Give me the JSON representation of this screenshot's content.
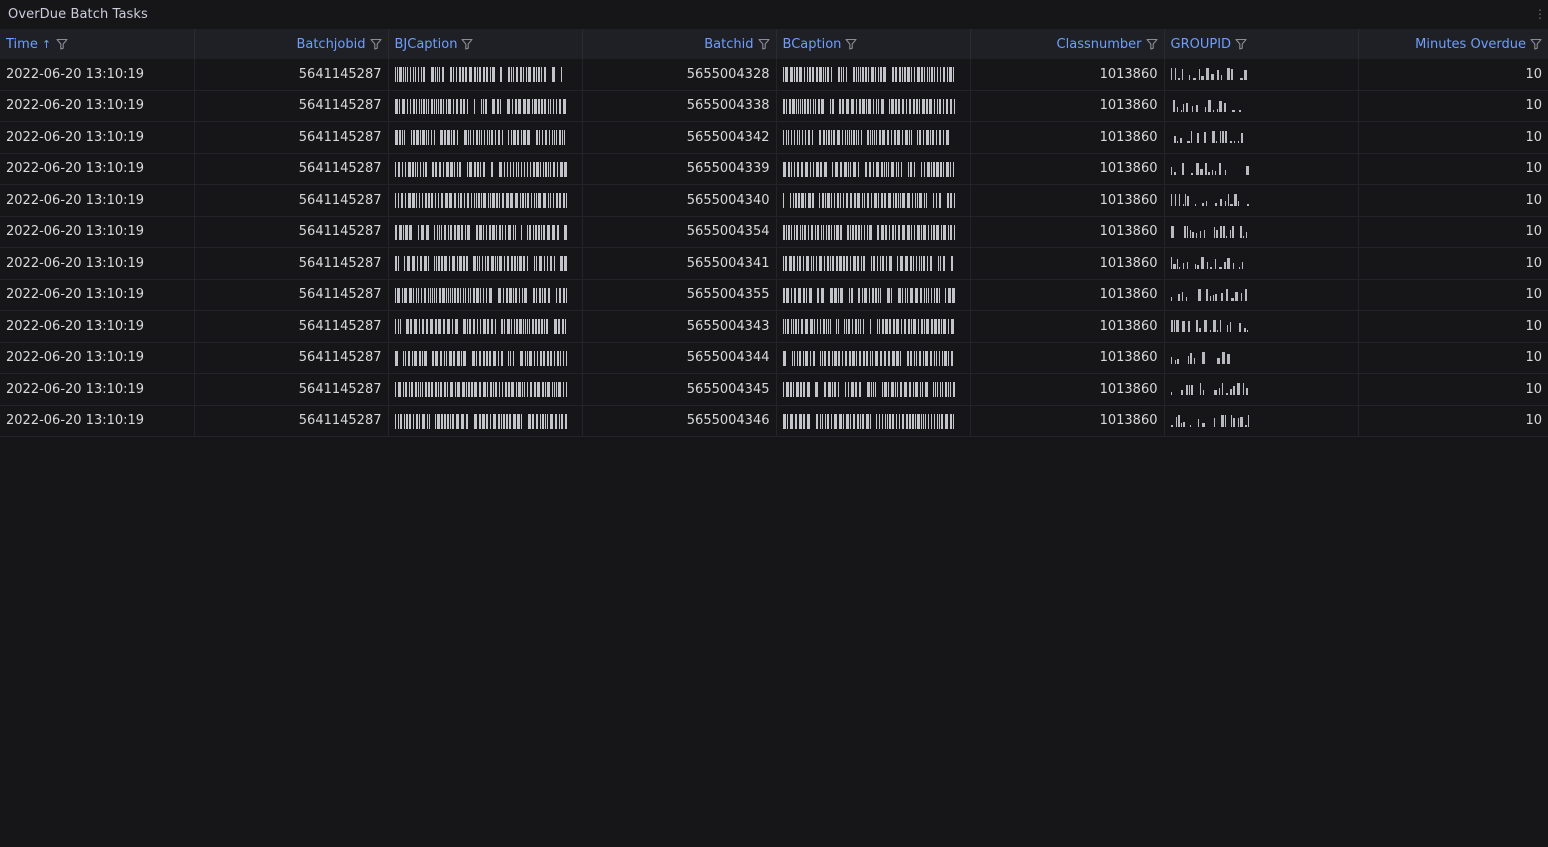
{
  "panel": {
    "title": "OverDue Batch Tasks",
    "menu_glyph": "⋮"
  },
  "table": {
    "columns": [
      {
        "label": "Time",
        "align": "left",
        "sorted": "asc",
        "sort_glyph": "↑"
      },
      {
        "label": "Batchjobid",
        "align": "right"
      },
      {
        "label": "BJCaption",
        "align": "left",
        "redacted": true
      },
      {
        "label": "Batchid",
        "align": "right"
      },
      {
        "label": "BCaption",
        "align": "left",
        "redacted": true
      },
      {
        "label": "Classnumber",
        "align": "right"
      },
      {
        "label": "GROUPID",
        "align": "left",
        "redacted": true
      },
      {
        "label": "Minutes Overdue",
        "align": "right"
      }
    ],
    "rows": [
      {
        "time": "2022-06-20 13:10:19",
        "batchjobid": "5641145287",
        "batchid": "5655004328",
        "classnumber": "1013860",
        "minutes_overdue": "10"
      },
      {
        "time": "2022-06-20 13:10:19",
        "batchjobid": "5641145287",
        "batchid": "5655004338",
        "classnumber": "1013860",
        "minutes_overdue": "10"
      },
      {
        "time": "2022-06-20 13:10:19",
        "batchjobid": "5641145287",
        "batchid": "5655004342",
        "classnumber": "1013860",
        "minutes_overdue": "10"
      },
      {
        "time": "2022-06-20 13:10:19",
        "batchjobid": "5641145287",
        "batchid": "5655004339",
        "classnumber": "1013860",
        "minutes_overdue": "10"
      },
      {
        "time": "2022-06-20 13:10:19",
        "batchjobid": "5641145287",
        "batchid": "5655004340",
        "classnumber": "1013860",
        "minutes_overdue": "10"
      },
      {
        "time": "2022-06-20 13:10:19",
        "batchjobid": "5641145287",
        "batchid": "5655004354",
        "classnumber": "1013860",
        "minutes_overdue": "10"
      },
      {
        "time": "2022-06-20 13:10:19",
        "batchjobid": "5641145287",
        "batchid": "5655004341",
        "classnumber": "1013860",
        "minutes_overdue": "10"
      },
      {
        "time": "2022-06-20 13:10:19",
        "batchjobid": "5641145287",
        "batchid": "5655004355",
        "classnumber": "1013860",
        "minutes_overdue": "10"
      },
      {
        "time": "2022-06-20 13:10:19",
        "batchjobid": "5641145287",
        "batchid": "5655004343",
        "classnumber": "1013860",
        "minutes_overdue": "10"
      },
      {
        "time": "2022-06-20 13:10:19",
        "batchjobid": "5641145287",
        "batchid": "5655004344",
        "classnumber": "1013860",
        "minutes_overdue": "10"
      },
      {
        "time": "2022-06-20 13:10:19",
        "batchjobid": "5641145287",
        "batchid": "5655004345",
        "classnumber": "1013860",
        "minutes_overdue": "10"
      },
      {
        "time": "2022-06-20 13:10:19",
        "batchjobid": "5641145287",
        "batchid": "5655004346",
        "classnumber": "1013860",
        "minutes_overdue": "10"
      }
    ]
  },
  "icons": {
    "filter": "filter-icon",
    "sort": "sort-ascending-icon",
    "menu": "kebab-menu-icon"
  },
  "colors": {
    "background": "#161618",
    "header_bg": "#1f2025",
    "header_text": "#6e9fff",
    "cell_text": "#d8d9da",
    "grid": "#232428"
  }
}
